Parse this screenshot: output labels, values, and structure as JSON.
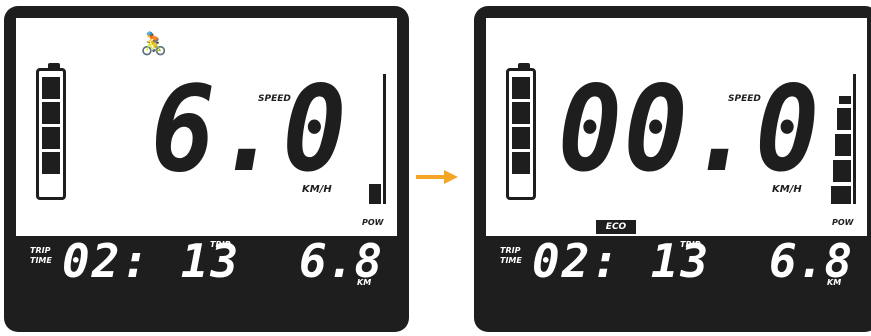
{
  "colors": {
    "panel": "#1e1e1e",
    "screen": "#ffffff",
    "arrow": "#f5a524"
  },
  "left": {
    "speed_value": "6.0",
    "speed_label": "SPEED",
    "unit_label": "KM/H",
    "pow_label": "POW",
    "battery_bars": 4,
    "pow_level_bars": 1,
    "bike_icon": "cyclist-icon",
    "trip_time_label_1": "TRIP",
    "trip_time_label_2": "TIME",
    "trip_time": "02: 13",
    "trip_label": "TRIP",
    "trip_distance": "6.8",
    "trip_unit": "KM"
  },
  "right": {
    "speed_value": "00.0",
    "speed_label": "SPEED",
    "unit_label": "KM/H",
    "pow_label": "POW",
    "battery_bars": 4,
    "pow_level_bars": 5,
    "mode": "ECO",
    "trip_time_label_1": "TRIP",
    "trip_time_label_2": "TIME",
    "trip_time": "02: 13",
    "trip_label": "TRIP",
    "trip_distance": "6.8",
    "trip_unit": "KM"
  }
}
